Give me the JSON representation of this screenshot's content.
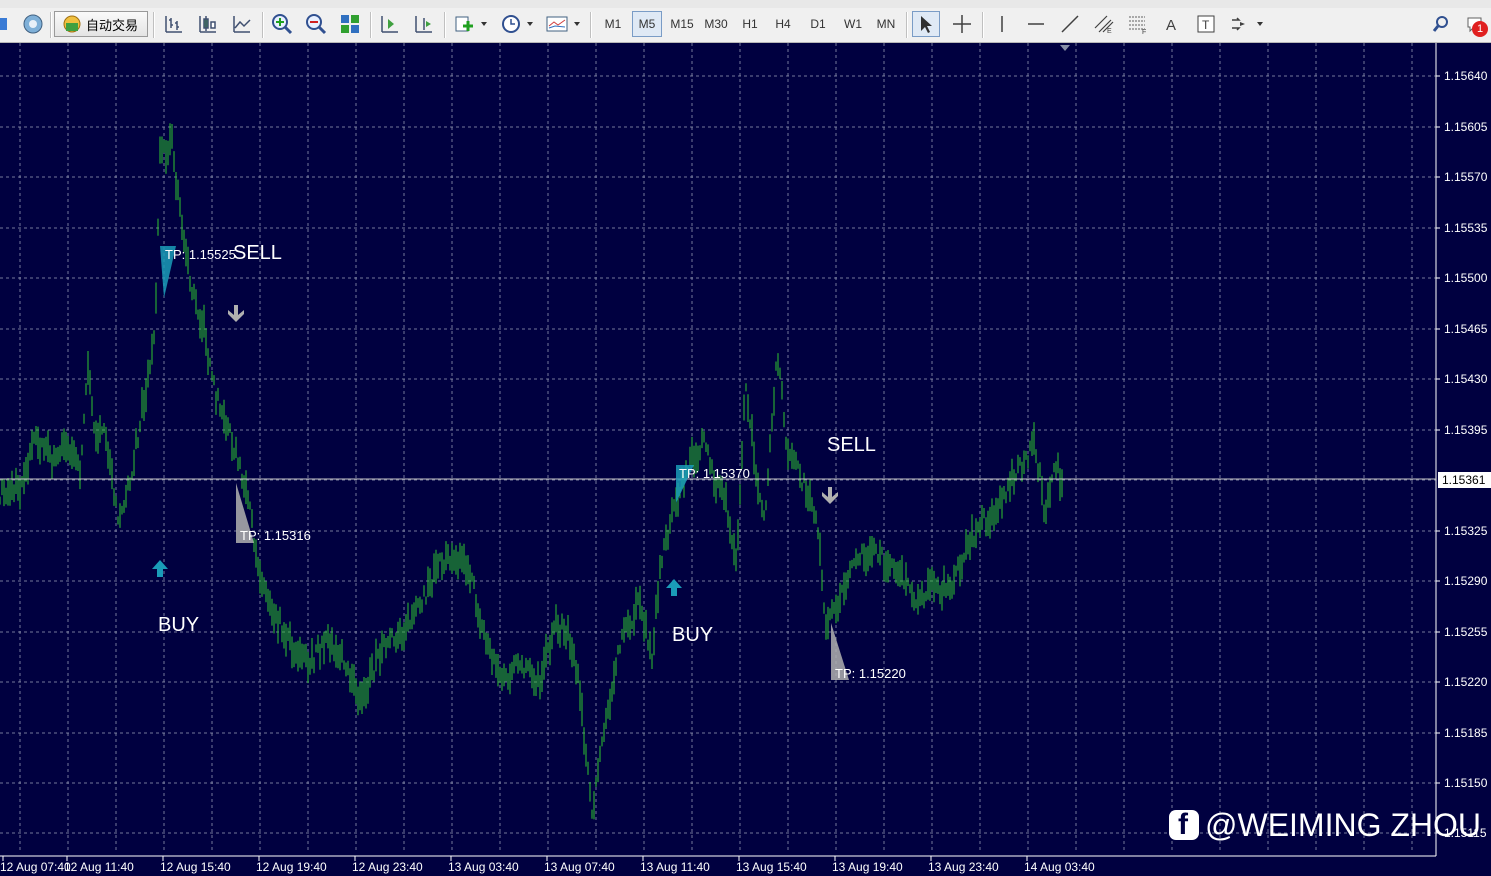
{
  "toolbar": {
    "autotrade_label": "自动交易",
    "timeframes": [
      "M1",
      "M5",
      "M15",
      "M30",
      "H1",
      "H4",
      "D1",
      "W1",
      "MN"
    ],
    "active_timeframe": "M5",
    "notification_count": "1"
  },
  "chart": {
    "price_labels": [
      "1.15640",
      "1.15605",
      "1.15570",
      "1.15535",
      "1.15500",
      "1.15465",
      "1.15430",
      "1.15395",
      "1.15361",
      "1.15325",
      "1.15290",
      "1.15255",
      "1.15220",
      "1.15185",
      "1.15150",
      "1.15115"
    ],
    "current_price": "1.15361",
    "time_labels": [
      "12 Aug 07:40",
      "12 Aug 11:40",
      "12 Aug 15:40",
      "12 Aug 19:40",
      "12 Aug 23:40",
      "13 Aug 03:40",
      "13 Aug 07:40",
      "13 Aug 11:40",
      "13 Aug 15:40",
      "13 Aug 19:40",
      "13 Aug 23:40",
      "14 Aug 03:40"
    ],
    "signals": [
      {
        "type": "BUY",
        "label": "BUY",
        "tp_label": "TP: 1.15525"
      },
      {
        "type": "SELL",
        "label": "SELL",
        "tp_label": "TP: 1.15316"
      },
      {
        "type": "BUY",
        "label": "BUY",
        "tp_label": "TP: 1.15370"
      },
      {
        "type": "SELL",
        "label": "SELL",
        "tp_label": "TP: 1.15220"
      }
    ],
    "colors": {
      "background": "#000040",
      "grid": "#9aa0b8",
      "bars": "#2ec62e",
      "text": "#ffffff",
      "buy": "#1a9cb8",
      "sell": "#b0b0b0"
    }
  },
  "watermark": "@WEIMING ZHOU"
}
